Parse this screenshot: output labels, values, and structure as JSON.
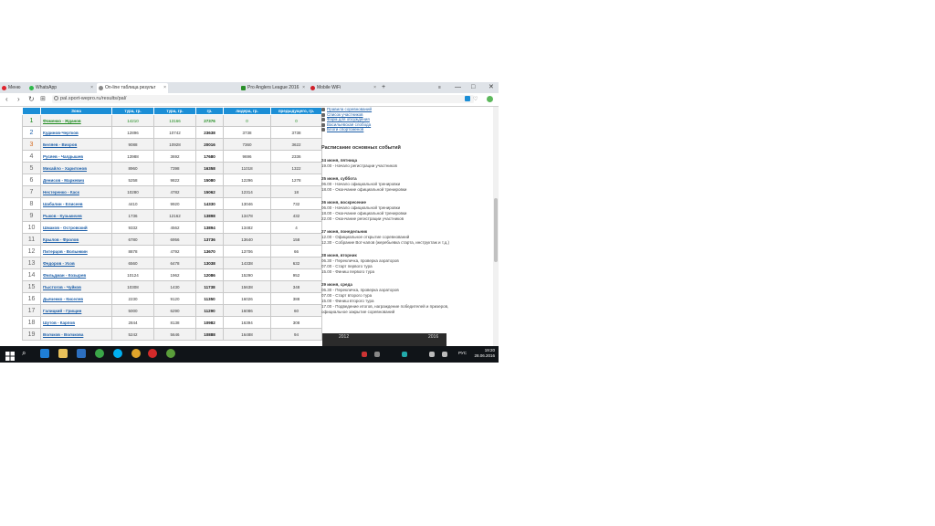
{
  "browser": {
    "menu_label": "Меню",
    "tabs": [
      {
        "label": "WhatsApp"
      },
      {
        "label": "On-line таблица результ"
      },
      {
        "label": ""
      },
      {
        "label": "Pro Anglers League 2016"
      },
      {
        "label": "Mobile WiFi"
      }
    ],
    "new_tab": "+",
    "url": "pal.sport-wepro.ru/results/pal/",
    "controls": {
      "minimize": "—",
      "maximize": "□",
      "close": "✕"
    }
  },
  "table": {
    "headers": [
      "",
      "Зона",
      "тура, гр.",
      "тура, гр.",
      "гр.",
      "лидера, гр.",
      "предыдущего, гр."
    ],
    "rows": [
      {
        "pos": "1",
        "name": "Фоменко - Жданов",
        "t1": "14210",
        "t2": "13166",
        "total": "27376",
        "gap_leader": "0",
        "gap_prev": "0"
      },
      {
        "pos": "2",
        "name": "Кудинов-Чертков",
        "t1": "12896",
        "t2": "10742",
        "total": "23638",
        "gap_leader": "3738",
        "gap_prev": "3738"
      },
      {
        "pos": "3",
        "name": "Беляев - Вихров",
        "t1": "9088",
        "t2": "10928",
        "total": "20016",
        "gap_leader": "7360",
        "gap_prev": "3622"
      },
      {
        "pos": "4",
        "name": "Русяев - Чалдышев",
        "t1": "13988",
        "t2": "3692",
        "total": "17680",
        "gap_leader": "9696",
        "gap_prev": "2336"
      },
      {
        "pos": "5",
        "name": "Михайло - Харитонов",
        "t1": "8960",
        "t2": "7398",
        "total": "16358",
        "gap_leader": "11018",
        "gap_prev": "1322"
      },
      {
        "pos": "6",
        "name": "Денисов - Маркевич",
        "t1": "5258",
        "t2": "9822",
        "total": "15080",
        "gap_leader": "12296",
        "gap_prev": "1278"
      },
      {
        "pos": "7",
        "name": "Нестеренко - Каск",
        "t1": "10280",
        "t2": "4782",
        "total": "15062",
        "gap_leader": "12314",
        "gap_prev": "18"
      },
      {
        "pos": "8",
        "name": "Шабалин - Елисеев",
        "t1": "4410",
        "t2": "9920",
        "total": "14330",
        "gap_leader": "13046",
        "gap_prev": "732"
      },
      {
        "pos": "9",
        "name": "Рыков - Кузьмичев",
        "t1": "1736",
        "t2": "12162",
        "total": "13898",
        "gap_leader": "13478",
        "gap_prev": "432"
      },
      {
        "pos": "10",
        "name": "Шмаков - Островский",
        "t1": "9332",
        "t2": "4562",
        "total": "13894",
        "gap_leader": "13482",
        "gap_prev": "4"
      },
      {
        "pos": "11",
        "name": "Крылов - Фролов",
        "t1": "6780",
        "t2": "6956",
        "total": "13736",
        "gap_leader": "13640",
        "gap_prev": "158"
      },
      {
        "pos": "12",
        "name": "Питерцов - Волынкин",
        "t1": "8878",
        "t2": "4792",
        "total": "13670",
        "gap_leader": "13706",
        "gap_prev": "66"
      },
      {
        "pos": "13",
        "name": "Федоров - Усов",
        "t1": "6560",
        "t2": "6478",
        "total": "13038",
        "gap_leader": "14338",
        "gap_prev": "632"
      },
      {
        "pos": "14",
        "name": "Фильдман - Козырев",
        "t1": "10124",
        "t2": "1962",
        "total": "12086",
        "gap_leader": "15290",
        "gap_prev": "952"
      },
      {
        "pos": "15",
        "name": "Пыстогов - Чуйков",
        "t1": "10308",
        "t2": "1430",
        "total": "11738",
        "gap_leader": "15638",
        "gap_prev": "348"
      },
      {
        "pos": "16",
        "name": "Дьяченко - Киселев",
        "t1": "2230",
        "t2": "9120",
        "total": "11350",
        "gap_leader": "16026",
        "gap_prev": "388"
      },
      {
        "pos": "17",
        "name": "Галицкий - Грищин",
        "t1": "5000",
        "t2": "6290",
        "total": "11290",
        "gap_leader": "16086",
        "gap_prev": "60"
      },
      {
        "pos": "18",
        "name": "Шутов - Карпов",
        "t1": "2844",
        "t2": "8138",
        "total": "10982",
        "gap_leader": "16394",
        "gap_prev": "308"
      },
      {
        "pos": "19",
        "name": "Волчков - Волчкова",
        "t1": "5242",
        "t2": "5646",
        "total": "10888",
        "gap_leader": "16488",
        "gap_prev": "94"
      }
    ]
  },
  "sidebar": {
    "links": [
      "Правила соревнований",
      "Список участников",
      "Фарм для обсуждения",
      "Васильевская слобода",
      "Блоги спортсменов"
    ],
    "schedule_title": "Расписание основных событий",
    "days": [
      {
        "head": "24 июня, пятница",
        "events": [
          "19.00 - Начало регистрации участников"
        ]
      },
      {
        "head": "25 июня, суббота",
        "events": [
          "06.00 - Начало официальной тренировки",
          "18.00 - Окончание официальной тренировки"
        ]
      },
      {
        "head": "26 июня, воскресение",
        "events": [
          "06.00 - Начало официальной тренировки",
          "18.00 - Окончание официальной тренировки",
          "22.00 - Окончание регистрации участников"
        ]
      },
      {
        "head": "27 июня, понедельник",
        "events": [
          "12.00 - Официальное открытие соревнований",
          "12.30 - Собрание Вот-капов (жеребьевка старта, инструктаж и т.д.)"
        ]
      },
      {
        "head": "28 июня, вторник",
        "events": [
          "06.30 - Перекличка, проверка аэраторов",
          "07.00 - Старт первого тура",
          "15.00 - Финиш первого тура"
        ]
      },
      {
        "head": "29 июня, среда",
        "events": [
          "06.30 - Перекличка, проверка аэраторов",
          "07.00 - Старт второго тура",
          "15.00 - Финиш второго тура",
          "17.00 - Подведение итогов, награждение победителей и призеров,",
          "официальное закрытие соревнований"
        ]
      }
    ],
    "photo_labels": [
      "2012",
      "2016"
    ]
  },
  "taskbar": {
    "lang": "РУС",
    "time": "19:20",
    "date": "28.06.2016"
  }
}
